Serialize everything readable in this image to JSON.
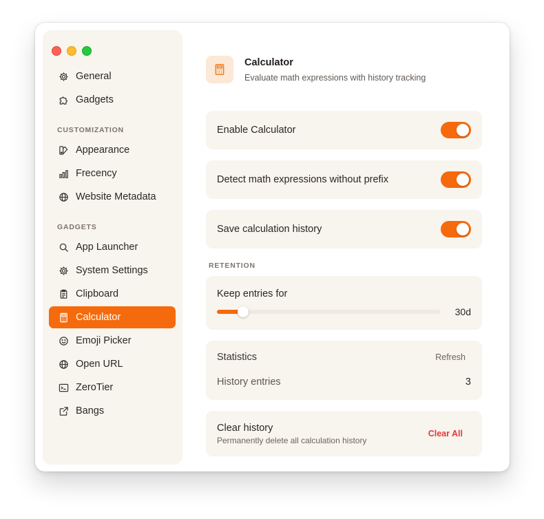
{
  "sidebar": {
    "window_controls": {
      "close": "#fe5f57",
      "minimize": "#febc2e",
      "zoom": "#28c840"
    },
    "top_items": [
      {
        "label": "General",
        "icon": "gear-icon"
      },
      {
        "label": "Gadgets",
        "icon": "puzzle-icon"
      }
    ],
    "customization_label": "CUSTOMIZATION",
    "customization_items": [
      {
        "label": "Appearance",
        "icon": "palette-icon"
      },
      {
        "label": "Frecency",
        "icon": "bar-chart-icon"
      },
      {
        "label": "Website Metadata",
        "icon": "globe-icon"
      }
    ],
    "gadgets_label": "GADGETS",
    "gadget_items": [
      {
        "label": "App Launcher",
        "icon": "search-icon"
      },
      {
        "label": "System Settings",
        "icon": "gear-icon"
      },
      {
        "label": "Clipboard",
        "icon": "clipboard-icon"
      },
      {
        "label": "Calculator",
        "icon": "calculator-icon",
        "active": true
      },
      {
        "label": "Emoji Picker",
        "icon": "smiley-icon"
      },
      {
        "label": "Open URL",
        "icon": "globe-icon"
      },
      {
        "label": "ZeroTier",
        "icon": "terminal-icon"
      },
      {
        "label": "Bangs",
        "icon": "external-link-icon"
      }
    ]
  },
  "header": {
    "title": "Calculator",
    "subtitle": "Evaluate math expressions with history tracking",
    "icon": "calculator-icon"
  },
  "settings": {
    "enable_label": "Enable Calculator",
    "enable_on": true,
    "detect_label": "Detect math expressions without prefix",
    "detect_on": true,
    "save_history_label": "Save calculation history",
    "save_history_on": true
  },
  "retention": {
    "section_label": "RETENTION",
    "keep_label": "Keep entries for",
    "value_label": "30d",
    "slider_fraction": 0.1
  },
  "statistics": {
    "title": "Statistics",
    "refresh_label": "Refresh",
    "history_label": "History entries",
    "history_value": "3"
  },
  "clear": {
    "title": "Clear history",
    "subtitle": "Permanently delete all calculation history",
    "button_label": "Clear All"
  },
  "colors": {
    "accent": "#f56a0c",
    "danger": "#e5383b",
    "card_bg": "#f8f4ee"
  }
}
